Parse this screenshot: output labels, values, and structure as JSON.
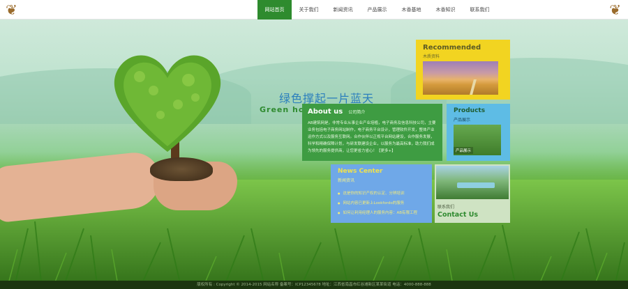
{
  "header": {
    "nav": [
      "网站首页",
      "关于我们",
      "新闻资讯",
      "产品展示",
      "木香基地",
      "木香知识",
      "联系我们"
    ],
    "active_index": 0
  },
  "slogan": {
    "cn": "绿色撑起一片蓝天",
    "en": "Green ho"
  },
  "recommended": {
    "title": "Recommended",
    "subtitle": "木质资料"
  },
  "about": {
    "title": "About us",
    "subtitle": "公司简介",
    "text": "AB建筑网是，非常专业从事企业产业培植，电子商务及信息科技公司，主要业务包括电子商务网站制作，电子商务平台设计，管理软件开发，整体产业运作方式以及服务互联网。合作伙伴以正规平台网站建设，合作服务发展，科学和精确保障计划，与研发联建设企业，以服务为最高标准，助力我们成为领先的服务提供商，让您更省力省心！【更多+】"
  },
  "products": {
    "title": "Products",
    "subtitle": "产品展示",
    "image_caption": "产品展示"
  },
  "news": {
    "title": "News Center",
    "subtitle": "新闻资讯",
    "items": [
      "这是你的知识产权的认定、分辨培训",
      "网站内容已更新上Lookfordo的服务",
      "如何让利用经理人的服务内容：AB有限工程"
    ]
  },
  "contact": {
    "subtitle": "联系我们",
    "title": "Contact Us"
  },
  "footer": {
    "text": "版权所有 : Copyright © 2014-2015 网站名称    备案号：ICP12345678    地址：江西省南昌市红谷滩新区某某街道    电话：4000-888-888"
  },
  "colors": {
    "nav_active": "#2e8b2e",
    "recommended_bg": "#f2d421",
    "about_bg": "#3e9c42",
    "products_bg": "#5ebce5",
    "news_bg": "#6fa8e8",
    "contact_bg": "#cfe3c3",
    "footer_bg": "#1c3510"
  }
}
